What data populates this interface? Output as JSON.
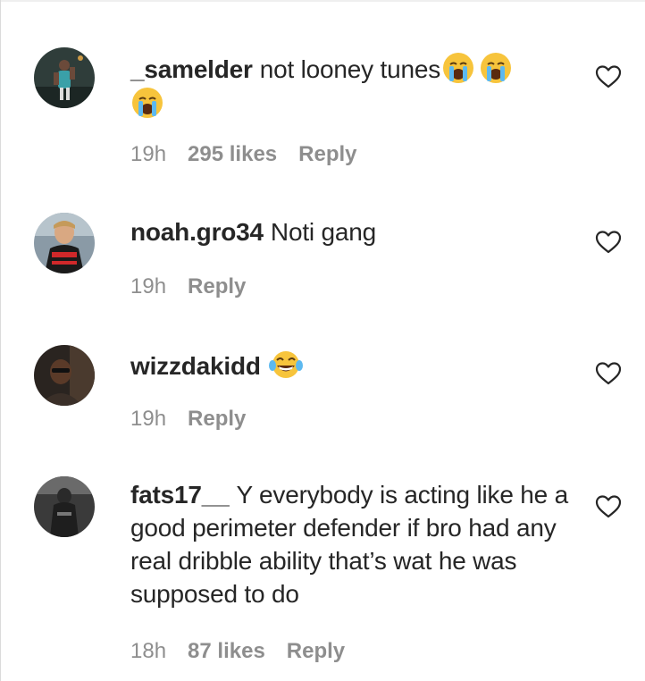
{
  "comments": [
    {
      "username": "_samelder",
      "text": "not looney tunes",
      "emojis": [
        "loudly-crying-face",
        "loudly-crying-face",
        "loudly-crying-face"
      ],
      "time": "19h",
      "likes": "295 likes",
      "reply": "Reply"
    },
    {
      "username": "noah.gro34",
      "text": "Noti gang",
      "emojis": [],
      "time": "19h",
      "likes": "",
      "reply": "Reply"
    },
    {
      "username": "wizzdakidd",
      "text": "",
      "emojis": [
        "face-with-tears-of-joy"
      ],
      "time": "19h",
      "likes": "",
      "reply": "Reply"
    },
    {
      "username": "fats17__",
      "text": "Y everybody is acting like he a good perimeter defender if bro had any real dribble ability that’s wat he was supposed to do",
      "emojis": [],
      "time": "18h",
      "likes": "87 likes",
      "reply": "Reply"
    }
  ],
  "icons": {
    "like": "heart-outline-icon"
  },
  "colors": {
    "text": "#262626",
    "meta": "#8e8e8e"
  }
}
